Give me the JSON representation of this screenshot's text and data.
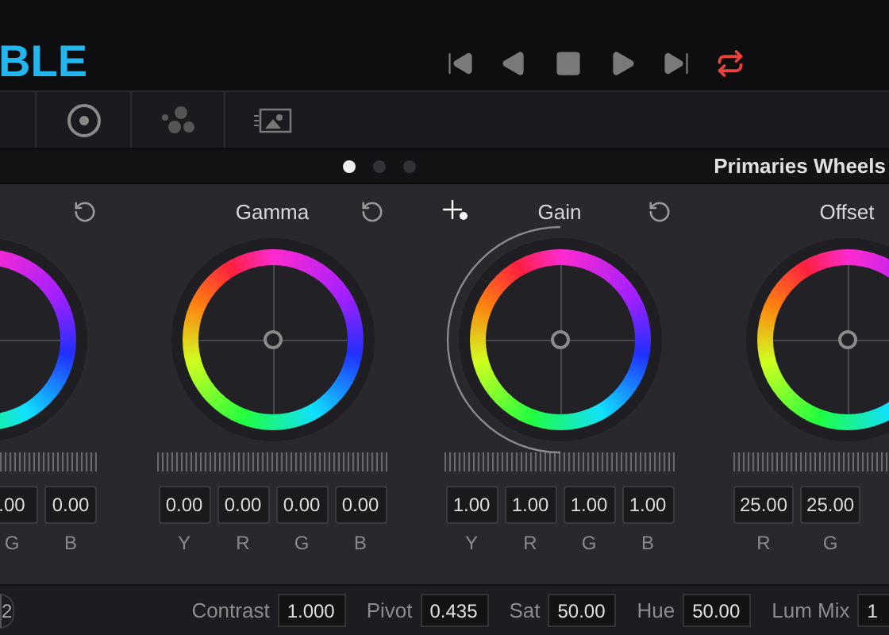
{
  "logo": {
    "text": "BLE"
  },
  "transport": [
    {
      "kind": "skip-back",
      "selected": false
    },
    {
      "kind": "reverse",
      "selected": false
    },
    {
      "kind": "stop",
      "selected": false
    },
    {
      "kind": "play",
      "selected": false
    },
    {
      "kind": "skip-forward",
      "selected": false
    },
    {
      "kind": "loop",
      "selected": true
    }
  ],
  "pages": [
    {
      "selected": true
    },
    {
      "selected": false
    },
    {
      "selected": false
    }
  ],
  "panel_title": "Primaries Wheels",
  "wheels": [
    {
      "values": [
        {
          "value": ".00",
          "label": "G"
        },
        {
          "value": "0.00",
          "label": "B"
        }
      ]
    },
    {
      "title": "Gamma",
      "hovered": false,
      "values": [
        {
          "value": "0.00",
          "label": "Y"
        },
        {
          "value": "0.00",
          "label": "R"
        },
        {
          "value": "0.00",
          "label": "G"
        },
        {
          "value": "0.00",
          "label": "B"
        }
      ]
    },
    {
      "title": "Gain",
      "hovered": true,
      "values": [
        {
          "value": "1.00",
          "label": "Y"
        },
        {
          "value": "1.00",
          "label": "R"
        },
        {
          "value": "1.00",
          "label": "G"
        },
        {
          "value": "1.00",
          "label": "B"
        }
      ]
    },
    {
      "title": "Offset",
      "hovered": false,
      "values": [
        {
          "value": "25.00",
          "label": "R"
        },
        {
          "value": "25.00",
          "label": "G"
        }
      ]
    }
  ],
  "page_button": "2",
  "adjustments": [
    {
      "label": "Contrast",
      "value": "1.000"
    },
    {
      "label": "Pivot",
      "value": "0.435"
    },
    {
      "label": "Sat",
      "value": "50.00"
    },
    {
      "label": "Hue",
      "value": "50.00"
    },
    {
      "label": "Lum Mix",
      "value": "1"
    }
  ]
}
